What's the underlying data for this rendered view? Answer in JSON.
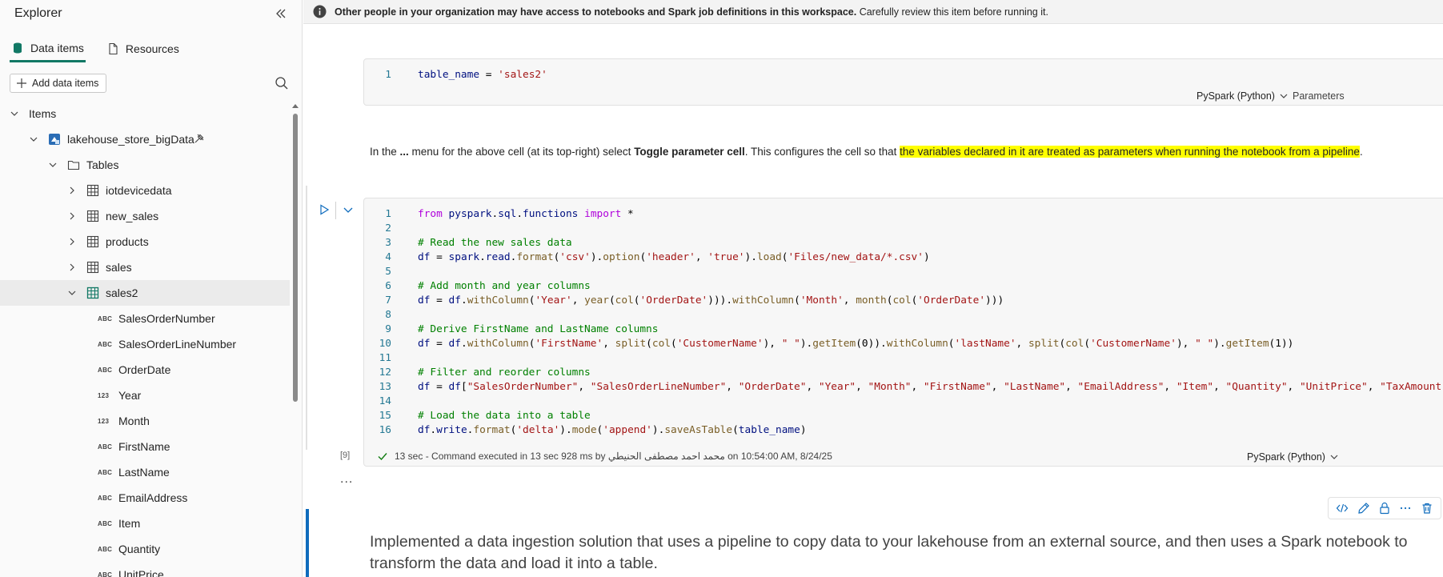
{
  "explorer": {
    "title": "Explorer",
    "tabs": [
      {
        "label": "Data items",
        "icon": "database-icon",
        "active": true
      },
      {
        "label": "Resources",
        "icon": "document-icon",
        "active": false
      }
    ],
    "add_button_label": "Add data items",
    "tree": {
      "items_label": "Items",
      "lakehouse_label": "lakehouse_store_bigData",
      "tables_label": "Tables",
      "tables": [
        "iotdevicedata",
        "new_sales",
        "products",
        "sales",
        "sales2"
      ],
      "selected_table": "sales2",
      "columns": [
        {
          "type": "ABC",
          "name": "SalesOrderNumber"
        },
        {
          "type": "ABC",
          "name": "SalesOrderLineNumber"
        },
        {
          "type": "ABC",
          "name": "OrderDate"
        },
        {
          "type": "123",
          "name": "Year"
        },
        {
          "type": "123",
          "name": "Month"
        },
        {
          "type": "ABC",
          "name": "FirstName"
        },
        {
          "type": "ABC",
          "name": "LastName"
        },
        {
          "type": "ABC",
          "name": "EmailAddress"
        },
        {
          "type": "ABC",
          "name": "Item"
        },
        {
          "type": "ABC",
          "name": "Quantity"
        },
        {
          "type": "ABC",
          "name": "UnitPrice"
        }
      ]
    }
  },
  "banner": {
    "bold_text": "Other people in your organization may have access to notebooks and Spark job definitions in this workspace.",
    "text": " Carefully review this item before running it."
  },
  "param_cell": {
    "line_number": "1",
    "language": "PySpark (Python)",
    "tag": "Parameters"
  },
  "markdown_1": {
    "part1": "In the ",
    "bold1": "...",
    "part2": " menu for the above cell (at its top-right) select ",
    "bold2": "Toggle parameter cell",
    "part3": ". This configures the cell so that ",
    "highlight": "the variables declared in it are treated as parameters when running the notebook from a pipeline",
    "part4": "."
  },
  "code_cell": {
    "line_numbers": [
      "1",
      "2",
      "3",
      "4",
      "5",
      "6",
      "7",
      "8",
      "9",
      "10",
      "11",
      "12",
      "13",
      "14",
      "15",
      "16"
    ],
    "execution_count": "[9]",
    "status": {
      "duration": "13 sec",
      "message": " - Command executed in 13 sec 928 ms by محمد احمد مصطفى الحنيطي on 10:54:00 AM, 8/24/25"
    },
    "language": "PySpark (Python)"
  },
  "more_label": "...",
  "toolbar_icons": [
    "code-icon",
    "edit-icon",
    "lock-icon",
    "more-icon",
    "delete-icon"
  ],
  "result_text": "Implemented a data ingestion solution that uses a pipeline to copy data to your lakehouse from an external source, and then uses a Spark notebook to transform the data and load it into a table.",
  "colors": {
    "accent": "#117865",
    "focus": "#0f6cbd",
    "highlight": "#ffff00"
  }
}
